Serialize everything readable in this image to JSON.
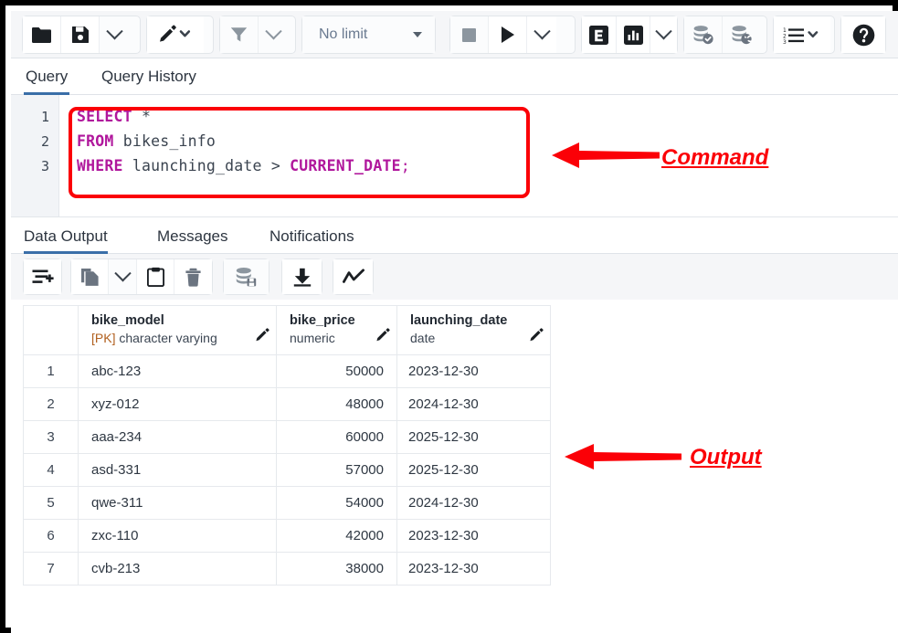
{
  "app": {
    "name": "pgAdmin Query Tool"
  },
  "toolbar": {
    "open_file_label": "Open File",
    "save_file_label": "Save File",
    "save_caret_label": "Save options",
    "edit_label": "Edit",
    "edit_caret_label": "Edit options",
    "filter_label": "Filter",
    "filter_caret_label": "Filter options",
    "limit_value": "No limit",
    "limit_caret_label": "Row limit options",
    "stop_label": "Stop",
    "execute_label": "Execute",
    "execute_caret_label": "Execute options",
    "explain_label": "Explain",
    "explain_analyze_label": "Explain Analyze",
    "explain_caret_label": "Explain options",
    "commit_label": "Commit",
    "rollback_label": "Rollback",
    "macros_label": "Macros",
    "macros_caret_label": "Macros options",
    "help_label": "Help"
  },
  "query_tabs": [
    {
      "label": "Query",
      "active": true
    },
    {
      "label": "Query History",
      "active": false
    }
  ],
  "editor": {
    "line_numbers": [
      "1",
      "2",
      "3"
    ],
    "lines": [
      {
        "keyword": "SELECT",
        "rest": " *"
      },
      {
        "keyword": "FROM",
        "rest": " bikes_info"
      },
      {
        "keyword": "WHERE",
        "rest": " launching_date > CURRENT_DATE;"
      }
    ],
    "sql_line1_kw": "SELECT",
    "sql_line1_star": "*",
    "sql_line2_kw": "FROM",
    "sql_line2_table": "bikes_info",
    "sql_line3_kw": "WHERE",
    "sql_line3_col": "launching_date",
    "sql_line3_op": ">",
    "sql_line3_fn": "CURRENT_DATE",
    "sql_line3_semi": ";"
  },
  "annotations": {
    "command_label": "Command",
    "output_label": "Output",
    "color": "#fb0007"
  },
  "output_tabs": [
    {
      "label": "Data Output",
      "active": true
    },
    {
      "label": "Messages",
      "active": false
    },
    {
      "label": "Notifications",
      "active": false
    }
  ],
  "grid_toolbar": {
    "add_row_label": "Add row",
    "copy_label": "Copy",
    "copy_caret_label": "Copy options",
    "paste_label": "Paste",
    "delete_label": "Delete row",
    "save_data_label": "Save Data Changes",
    "download_label": "Download as CSV",
    "graph_label": "Graph Visualiser"
  },
  "result_grid": {
    "columns": [
      {
        "name": "bike_model",
        "type": "[PK] character varying",
        "pk_prefix": "[PK]",
        "type_rest": "character varying"
      },
      {
        "name": "bike_price",
        "type": "numeric"
      },
      {
        "name": "launching_date",
        "type": "date"
      }
    ],
    "rows": [
      {
        "num": "1",
        "bike_model": "abc-123",
        "bike_price": "50000",
        "launching_date": "2023-12-30"
      },
      {
        "num": "2",
        "bike_model": "xyz-012",
        "bike_price": "48000",
        "launching_date": "2024-12-30"
      },
      {
        "num": "3",
        "bike_model": "aaa-234",
        "bike_price": "60000",
        "launching_date": "2025-12-30"
      },
      {
        "num": "4",
        "bike_model": "asd-331",
        "bike_price": "57000",
        "launching_date": "2025-12-30"
      },
      {
        "num": "5",
        "bike_model": "qwe-311",
        "bike_price": "54000",
        "launching_date": "2024-12-30"
      },
      {
        "num": "6",
        "bike_model": "zxc-110",
        "bike_price": "42000",
        "launching_date": "2023-12-30"
      },
      {
        "num": "7",
        "bike_model": "cvb-213",
        "bike_price": "38000",
        "launching_date": "2023-12-30"
      }
    ]
  },
  "colors": {
    "accent_tab": "#3a6ea8",
    "keyword": "#b0179c",
    "annotation_red": "#fb0007",
    "toolbar_bg": "#f5f6f8",
    "pk_orange": "#b1601f"
  }
}
